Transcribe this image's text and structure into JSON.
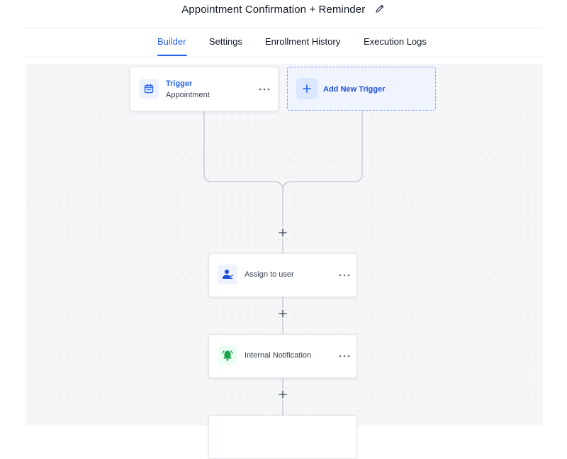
{
  "header": {
    "title": "Appointment Confirmation + Reminder",
    "edit_icon": "pencil-icon"
  },
  "tabs": [
    {
      "label": "Builder",
      "active": true
    },
    {
      "label": "Settings",
      "active": false
    },
    {
      "label": "Enrollment History",
      "active": false
    },
    {
      "label": "Execution Logs",
      "active": false
    }
  ],
  "workflow": {
    "trigger": {
      "title": "Trigger",
      "subtitle": "Appointment",
      "icon": "calendar-icon",
      "menu_icon": "more-horizontal-icon"
    },
    "add_trigger": {
      "label": "Add New Trigger",
      "icon": "plus-icon"
    },
    "actions": [
      {
        "label": "Assign to user",
        "icon": "assign-user-icon",
        "menu_icon": "more-horizontal-icon"
      },
      {
        "label": "Internal Notification",
        "icon": "bell-icon",
        "menu_icon": "more-horizontal-icon"
      },
      {
        "label": "",
        "icon": "",
        "menu_icon": ""
      }
    ]
  },
  "colors": {
    "accent": "#2563eb",
    "notification_green": "#16a34a",
    "assign_blue": "#1d4ed8"
  }
}
